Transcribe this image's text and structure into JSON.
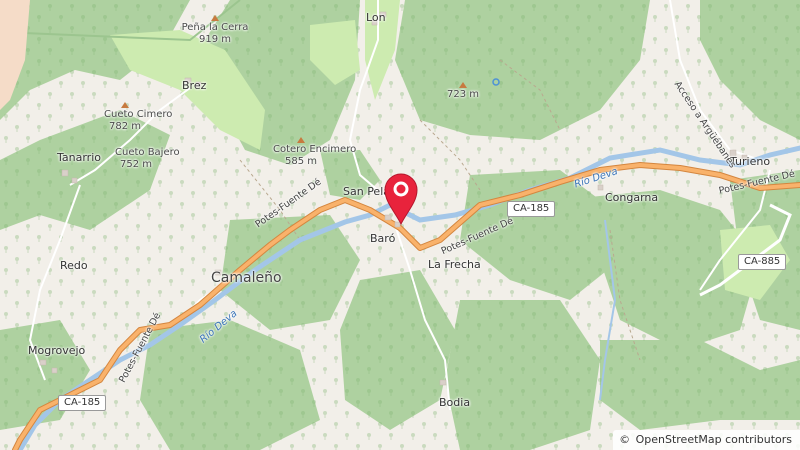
{
  "places": {
    "lon": "Lon",
    "brez": "Brez",
    "tanarrio": "Tanarrio",
    "san_pelayo": "San Pela",
    "baro": "Baró",
    "la_frecha": "La Frecha",
    "congarna": "Congarna",
    "turieno": "Turieno",
    "redo": "Redo",
    "camaleno": "Camaleño",
    "mogrovejo": "Mogrovejo",
    "bodia": "Bodia"
  },
  "peaks": {
    "pena_la_cerra": {
      "name": "Peña la Cerra",
      "elev": "919 m"
    },
    "cueto_cimero": {
      "name": "Cueto Cimero",
      "elev": "782 m"
    },
    "cueto_bajero": {
      "name": "Cueto Bajero",
      "elev": "752 m"
    },
    "cotero_encimero": {
      "name": "Cotero Encimero",
      "elev": "585 m"
    },
    "unnamed_723": {
      "elev": "723 m"
    }
  },
  "roads": {
    "potes_fuente_de_1": "Potes-Fuente Dé",
    "potes_fuente_de_2": "Potes-Fuente Dé",
    "potes_fuente_de_3": "Potes-Fuente Dé",
    "potes_fuente_de_4": "Potes-Fuente Dé",
    "acceso_arguebanes": "Acceso a Argüébanes",
    "shield_ca185_a": "CA-185",
    "shield_ca185_b": "CA-185",
    "shield_ca885": "CA-885"
  },
  "rivers": {
    "rio_deva_1": "Río Deva",
    "rio_deva_2": "Río Deva"
  },
  "attribution": {
    "symbol": "©",
    "text": "OpenStreetMap contributors"
  },
  "colors": {
    "forest": "#aed1a0",
    "forest_dark": "#9cc58f",
    "grass": "#cdebb0",
    "land": "#f2efe9",
    "road": "#f9b26b",
    "road_casing": "#d4863f",
    "river": "#a3c6e8",
    "marker": "#e8233c"
  }
}
